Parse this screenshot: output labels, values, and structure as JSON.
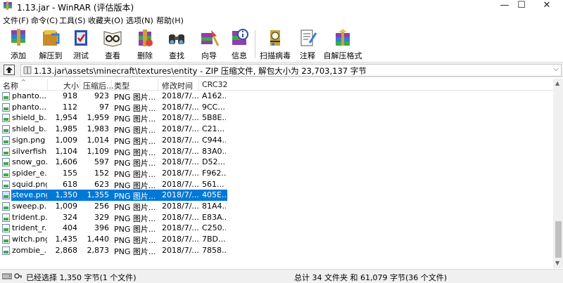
{
  "window": {
    "title": "1.13.jar - WinRAR (评估版本)",
    "controls": {
      "minimize": "—",
      "maximize": "☐",
      "close": "✕"
    }
  },
  "menu": [
    "文件(F)",
    "命令(C)",
    "工具(S)",
    "收藏夹(O)",
    "选项(N)",
    "帮助(H)"
  ],
  "toolbar": [
    {
      "label": "添加",
      "icon": "add-archive-icon"
    },
    {
      "label": "解压到",
      "icon": "extract-to-icon"
    },
    {
      "label": "测试",
      "icon": "test-icon"
    },
    {
      "label": "查看",
      "icon": "view-icon"
    },
    {
      "label": "删除",
      "icon": "delete-icon"
    },
    {
      "label": "查找",
      "icon": "find-icon"
    },
    {
      "label": "向导",
      "icon": "wizard-icon"
    },
    {
      "label": "信息",
      "icon": "info-icon"
    },
    {
      "label": "扫描病毒",
      "icon": "virus-scan-icon"
    },
    {
      "label": "注释",
      "icon": "comment-icon"
    },
    {
      "label": "自解压格式",
      "icon": "sfx-icon"
    }
  ],
  "address": {
    "path": "1.13.jar\\assets\\minecraft\\textures\\entity - ZIP 压缩文件, 解包大小为 23,703,137 字节"
  },
  "columns": {
    "name": "名称",
    "size": "大小",
    "packed": "压缩后...",
    "type": "类型",
    "modified": "修改时间",
    "crc": "CRC32"
  },
  "files": [
    {
      "name": "phanto...",
      "size": "918",
      "packed": "923",
      "type": "PNG 图片...",
      "modified": "2018/7/...",
      "crc": "A162...",
      "selected": false
    },
    {
      "name": "phanto...",
      "size": "112",
      "packed": "97",
      "type": "PNG 图片...",
      "modified": "2018/7/...",
      "crc": "9CC...",
      "selected": false
    },
    {
      "name": "shield_b...",
      "size": "1,954",
      "packed": "1,959",
      "type": "PNG 图片...",
      "modified": "2018/7/...",
      "crc": "5B8E...",
      "selected": false
    },
    {
      "name": "shield_b...",
      "size": "1,985",
      "packed": "1,983",
      "type": "PNG 图片...",
      "modified": "2018/7/...",
      "crc": "C21...",
      "selected": false
    },
    {
      "name": "sign.png",
      "size": "1,009",
      "packed": "1,014",
      "type": "PNG 图片...",
      "modified": "2018/7/...",
      "crc": "C944...",
      "selected": false
    },
    {
      "name": "silverfish...",
      "size": "1,104",
      "packed": "1,109",
      "type": "PNG 图片...",
      "modified": "2018/7/...",
      "crc": "83A0...",
      "selected": false
    },
    {
      "name": "snow_go...",
      "size": "1,606",
      "packed": "597",
      "type": "PNG 图片...",
      "modified": "2018/7/...",
      "crc": "D52...",
      "selected": false
    },
    {
      "name": "spider_e...",
      "size": "155",
      "packed": "152",
      "type": "PNG 图片...",
      "modified": "2018/7/...",
      "crc": "F962...",
      "selected": false
    },
    {
      "name": "squid.png",
      "size": "618",
      "packed": "623",
      "type": "PNG 图片...",
      "modified": "2018/7/...",
      "crc": "561...",
      "selected": false
    },
    {
      "name": "steve.png",
      "size": "1,350",
      "packed": "1,355",
      "type": "PNG 图片...",
      "modified": "2018/7/...",
      "crc": "405E...",
      "selected": true
    },
    {
      "name": "sweep.p...",
      "size": "1,009",
      "packed": "256",
      "type": "PNG 图片...",
      "modified": "2018/7/...",
      "crc": "81A4...",
      "selected": false
    },
    {
      "name": "trident.p...",
      "size": "324",
      "packed": "329",
      "type": "PNG 图片...",
      "modified": "2018/7/...",
      "crc": "E83A...",
      "selected": false
    },
    {
      "name": "trident_r...",
      "size": "404",
      "packed": "396",
      "type": "PNG 图片...",
      "modified": "2018/7/...",
      "crc": "C250...",
      "selected": false
    },
    {
      "name": "witch.png",
      "size": "1,435",
      "packed": "1,440",
      "type": "PNG 图片...",
      "modified": "2018/7/...",
      "crc": "7BD...",
      "selected": false
    },
    {
      "name": "zombie_...",
      "size": "2,868",
      "packed": "2,873",
      "type": "PNG 图片...",
      "modified": "2018/7/...",
      "crc": "7858...",
      "selected": false
    }
  ],
  "status": {
    "left": "已经选择 1,350 字节(1 个文件)",
    "right": "总计 34 文件夹 和 61,079 字节(36 个文件)"
  },
  "colors": {
    "selection": "#0078d7"
  }
}
